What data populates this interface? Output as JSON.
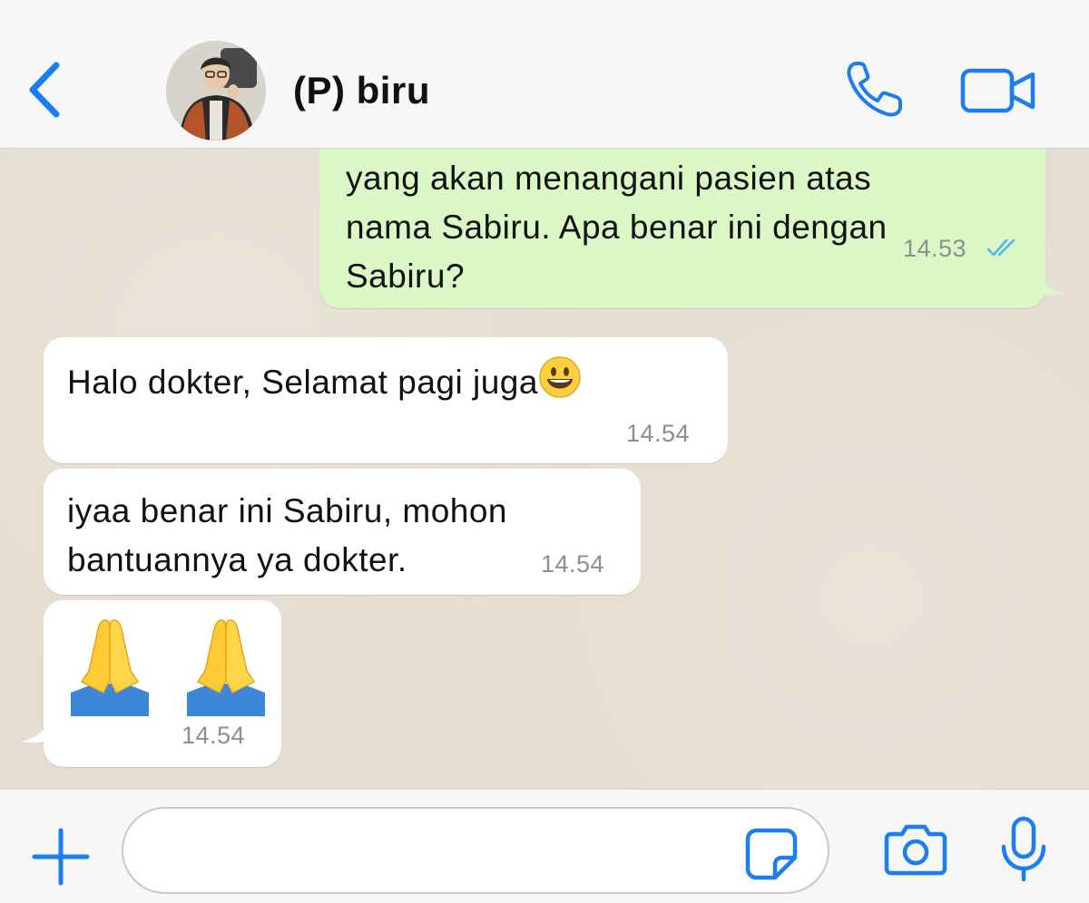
{
  "header": {
    "contact_name": "(P) biru",
    "icons": {
      "back": "chevron-left-icon",
      "call": "phone-icon",
      "video": "video-camera-icon"
    }
  },
  "messages": [
    {
      "direction": "outgoing",
      "text": "yang akan menangani pasien atas\nnama Sabiru. Apa benar ini dengan\nSabiru?",
      "time": "14.53",
      "status": "read"
    },
    {
      "direction": "incoming",
      "text": "Halo dokter, Selamat pagi juga",
      "emoji": "smiling-face-icon",
      "time": "14.54"
    },
    {
      "direction": "incoming",
      "text": "iyaa benar ini Sabiru, mohon\nbantuannya ya dokter.",
      "time": "14.54"
    },
    {
      "direction": "incoming",
      "emoji": "folded-hands-icon",
      "emoji_count": 2,
      "time": "14.54"
    }
  ],
  "input": {
    "placeholder": "",
    "icons": {
      "plus": "plus-icon",
      "sticker": "sticker-icon",
      "camera": "camera-icon",
      "mic": "microphone-icon"
    }
  },
  "colors": {
    "accent": "#1a7ef2",
    "outgoing_bubble": "#dcf7c6",
    "incoming_bubble": "#ffffff",
    "chat_background": "#e5ddd1",
    "read_ticks": "#4fb6ec",
    "timestamp": "#8a8f93"
  }
}
